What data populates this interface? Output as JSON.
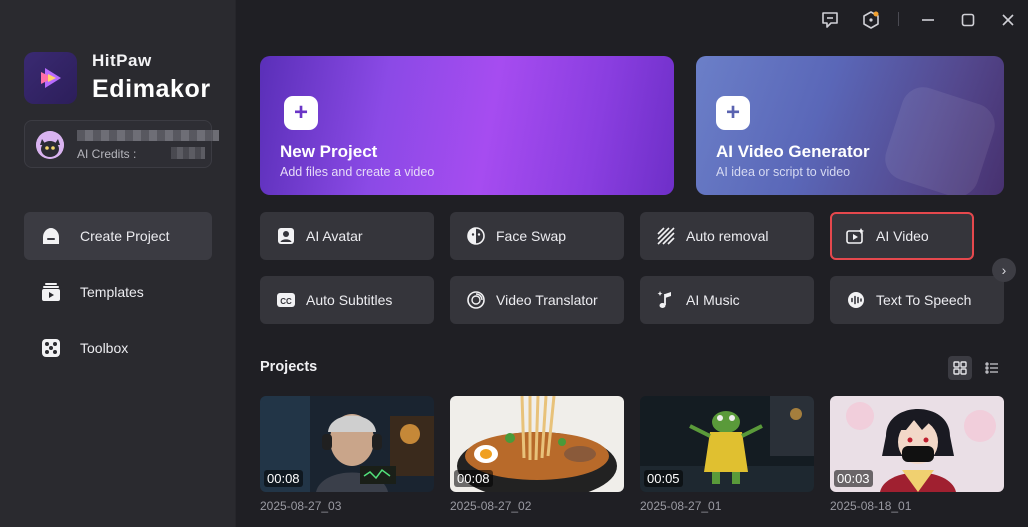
{
  "app": {
    "brand_top": "HitPaw",
    "brand_bottom": "Edimakor"
  },
  "account": {
    "credits_label": "AI Credits :"
  },
  "sidebar": {
    "items": [
      {
        "label": "Create Project",
        "icon": "home-icon",
        "active": true
      },
      {
        "label": "Templates",
        "icon": "templates-icon",
        "active": false
      },
      {
        "label": "Toolbox",
        "icon": "toolbox-icon",
        "active": false
      }
    ]
  },
  "titlebar": {
    "icons": [
      "feedback-icon",
      "notification-icon",
      "minimize-icon",
      "maximize-icon",
      "close-icon"
    ]
  },
  "hero": {
    "new_project": {
      "title": "New Project",
      "subtitle": "Add files and create a video"
    },
    "ai_generator": {
      "title": "AI Video Generator",
      "subtitle": "AI idea or script to video"
    }
  },
  "tools": [
    {
      "label": "AI Avatar",
      "icon": "avatar-icon"
    },
    {
      "label": "Face Swap",
      "icon": "face-swap-icon"
    },
    {
      "label": "Auto removal",
      "icon": "auto-removal-icon"
    },
    {
      "label": "AI Video",
      "icon": "ai-video-icon",
      "highlighted": true
    },
    {
      "label": "Auto Subtitles",
      "icon": "subtitles-icon"
    },
    {
      "label": "Video Translator",
      "icon": "translator-icon"
    },
    {
      "label": "AI Music",
      "icon": "music-icon"
    },
    {
      "label": "Text To Speech",
      "icon": "speech-icon"
    }
  ],
  "projects": {
    "title": "Projects",
    "items": [
      {
        "name": "2025-08-27_03",
        "duration": "00:08"
      },
      {
        "name": "2025-08-27_02",
        "duration": "00:08"
      },
      {
        "name": "2025-08-27_01",
        "duration": "00:05"
      },
      {
        "name": "2025-08-18_01",
        "duration": "00:03"
      }
    ]
  },
  "colors": {
    "accent_highlight": "#e5484d",
    "new_project_gradient": "#8b4ae6",
    "ai_generator_gradient": "#5a67b8"
  }
}
